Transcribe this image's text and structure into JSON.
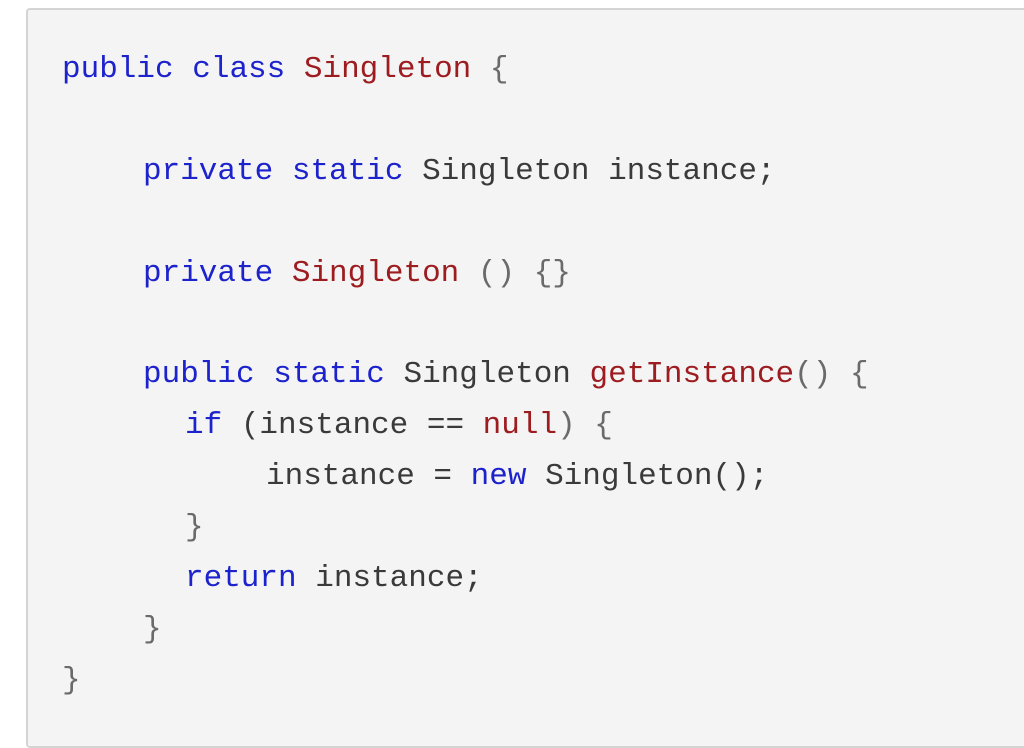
{
  "code": {
    "language": "java",
    "lines": [
      {
        "tokens": [
          {
            "t": "public",
            "c": "kw"
          },
          {
            "t": " ",
            "c": "nm"
          },
          {
            "t": "class",
            "c": "kw"
          },
          {
            "t": " ",
            "c": "nm"
          },
          {
            "t": "Singleton",
            "c": "ty"
          },
          {
            "t": " ",
            "c": "nm"
          },
          {
            "t": "{",
            "c": "pn"
          }
        ]
      },
      {
        "tokens": [
          {
            "t": "private",
            "c": "kw"
          },
          {
            "t": " ",
            "c": "nm"
          },
          {
            "t": "static",
            "c": "kw"
          },
          {
            "t": " ",
            "c": "nm"
          },
          {
            "t": "Singleton instance;",
            "c": "nm"
          }
        ]
      },
      {
        "tokens": [
          {
            "t": "private",
            "c": "kw"
          },
          {
            "t": " ",
            "c": "nm"
          },
          {
            "t": "Singleton",
            "c": "ty"
          },
          {
            "t": " ",
            "c": "nm"
          },
          {
            "t": "() {}",
            "c": "pn"
          }
        ]
      },
      {
        "tokens": [
          {
            "t": "public",
            "c": "kw"
          },
          {
            "t": " ",
            "c": "nm"
          },
          {
            "t": "static",
            "c": "kw"
          },
          {
            "t": " ",
            "c": "nm"
          },
          {
            "t": "Singleton",
            "c": "nm"
          },
          {
            "t": " ",
            "c": "nm"
          },
          {
            "t": "getInstance",
            "c": "ty"
          },
          {
            "t": "() {",
            "c": "pn"
          }
        ]
      },
      {
        "tokens": [
          {
            "t": "if",
            "c": "kw"
          },
          {
            "t": " (instance == ",
            "c": "nm"
          },
          {
            "t": "null",
            "c": "ty"
          },
          {
            "t": ") {",
            "c": "pn"
          }
        ]
      },
      {
        "tokens": [
          {
            "t": "instance = ",
            "c": "nm"
          },
          {
            "t": "new",
            "c": "kw"
          },
          {
            "t": " ",
            "c": "nm"
          },
          {
            "t": "Singleton();",
            "c": "nm"
          }
        ]
      },
      {
        "tokens": [
          {
            "t": "}",
            "c": "pn"
          }
        ]
      },
      {
        "tokens": [
          {
            "t": "return",
            "c": "kw"
          },
          {
            "t": " ",
            "c": "nm"
          },
          {
            "t": "instance;",
            "c": "nm"
          }
        ]
      },
      {
        "tokens": [
          {
            "t": "}",
            "c": "pn"
          }
        ]
      },
      {
        "tokens": [
          {
            "t": "}",
            "c": "pn"
          }
        ]
      }
    ]
  },
  "colors": {
    "keyword": "#1c22cc",
    "type_name": "#9d1c20",
    "plain": "#3a3a3a",
    "punctuation": "#6a6a6a",
    "background": "#f4f4f4",
    "border": "#d4d4d4"
  }
}
